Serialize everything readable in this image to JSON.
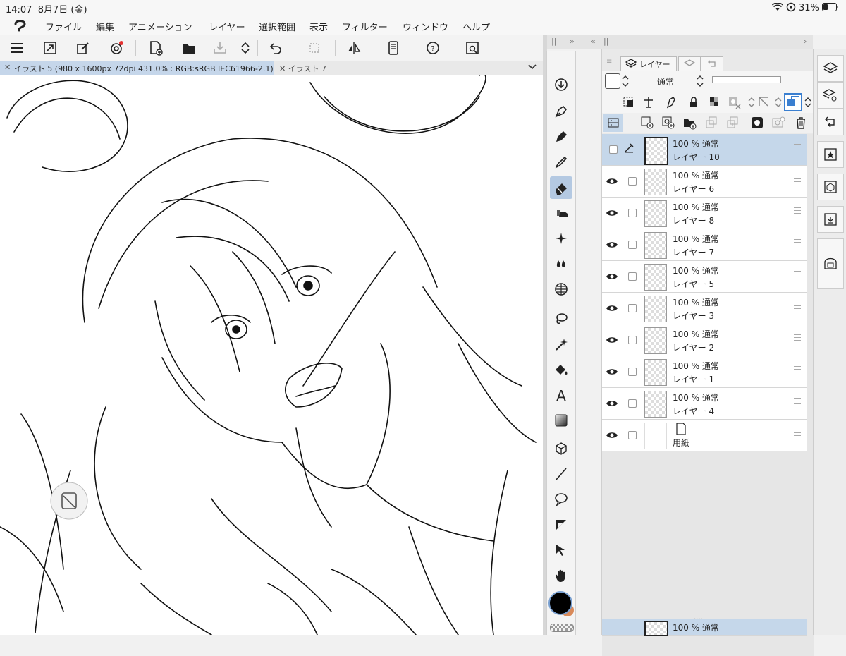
{
  "status": {
    "time": "14:07",
    "date": "8月7日 (金)",
    "battery": "31%"
  },
  "menu": {
    "items": [
      "ファイル",
      "編集",
      "アニメーション",
      "レイヤー",
      "選択範囲",
      "表示",
      "フィルター",
      "ウィンドウ",
      "ヘルプ"
    ]
  },
  "tabs": {
    "active": "イラスト 5 (980 x 1600px 72dpi 431.0% : RGB:sRGB IEC61966-2.1)",
    "second": "イラスト 7"
  },
  "layer_panel": {
    "tab_label": "レイヤー",
    "blend_mode": "通常",
    "layers": [
      {
        "opacity_mode": "100 % 通常",
        "name": "レイヤー 10",
        "selected": true
      },
      {
        "opacity_mode": "100 % 通常",
        "name": "レイヤー 6"
      },
      {
        "opacity_mode": "100 % 通常",
        "name": "レイヤー 8"
      },
      {
        "opacity_mode": "100 % 通常",
        "name": "レイヤー 7"
      },
      {
        "opacity_mode": "100 % 通常",
        "name": "レイヤー 5"
      },
      {
        "opacity_mode": "100 % 通常",
        "name": "レイヤー 3"
      },
      {
        "opacity_mode": "100 % 通常",
        "name": "レイヤー 2"
      },
      {
        "opacity_mode": "100 % 通常",
        "name": "レイヤー 1"
      },
      {
        "opacity_mode": "100 % 通常",
        "name": "レイヤー 4"
      },
      {
        "opacity_mode": "",
        "name": "用紙"
      }
    ],
    "bottom_layer": {
      "opacity_mode": "100 % 通常"
    }
  },
  "colors": {
    "main_color": "#000000",
    "sub_color": "#d98a5a",
    "accent": "#c5d7ea"
  }
}
